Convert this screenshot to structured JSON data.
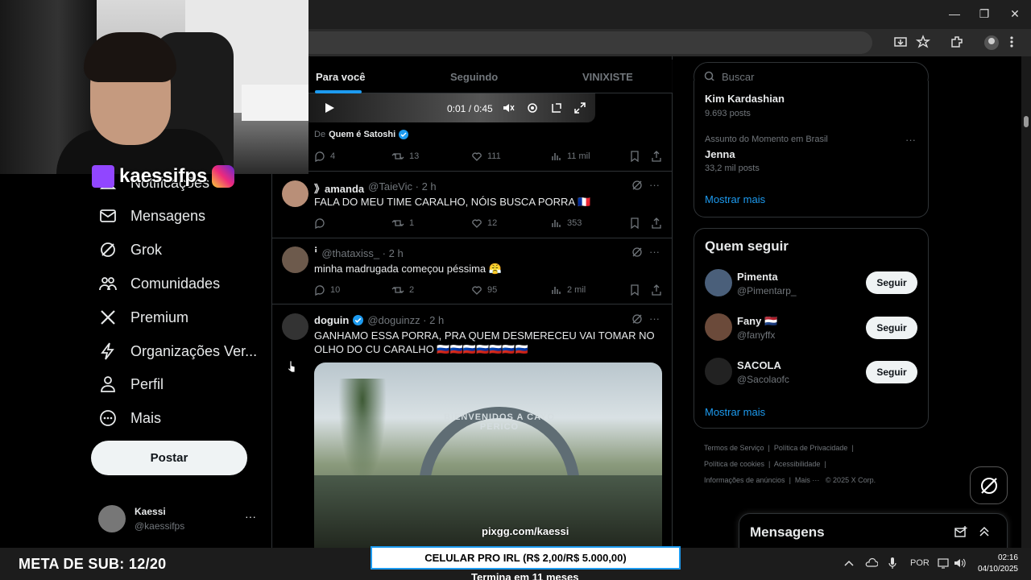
{
  "browser": {
    "window_controls": {
      "minimize": "—",
      "restore": "❐",
      "close": "✕"
    }
  },
  "stream": {
    "channel_name": "kaessifps",
    "meta_sub": "META DE SUB: 12/20",
    "goal_banner": "CELULAR PRO IRL (R$ 2,00/R$ 5.000,00)",
    "goal_sub": "Termina em 11 meses",
    "watermark": "pixgg.com/kaessi"
  },
  "sidebar": {
    "items": [
      {
        "label": "Notificações",
        "icon": "bell-icon"
      },
      {
        "label": "Mensagens",
        "icon": "mail-icon"
      },
      {
        "label": "Grok",
        "icon": "grok-icon"
      },
      {
        "label": "Comunidades",
        "icon": "communities-icon"
      },
      {
        "label": "Premium",
        "icon": "x-logo-icon"
      },
      {
        "label": "Organizações Ver...",
        "icon": "lightning-icon"
      },
      {
        "label": "Perfil",
        "icon": "person-icon"
      },
      {
        "label": "Mais",
        "icon": "more-circle-icon"
      }
    ],
    "post_button": "Postar",
    "account": {
      "name": "Kaessi",
      "handle": "@kaessifps",
      "more": "···"
    }
  },
  "feed": {
    "tabs": [
      "Para você",
      "Seguindo",
      "VINIXISTE"
    ],
    "video": {
      "time": "0:01 / 0:45"
    },
    "tweets": [
      {
        "from_prefix": "De",
        "from_name": "Quem é Satoshi",
        "replies": "4",
        "reposts": "13",
        "likes": "111",
        "views": "11 mil"
      },
      {
        "name": "》amanda",
        "handle": "@TaieVic · 2 h",
        "text": "FALA DO MEU TIME CARALHO, NÓIS BUSCA PORRA 🇫🇷",
        "replies": "",
        "reposts": "1",
        "likes": "12",
        "views": "353"
      },
      {
        "name": "ꜞ",
        "handle": "@thataxiss_ · 2 h",
        "text": "minha madrugada começou péssima 😤",
        "replies": "10",
        "reposts": "2",
        "likes": "95",
        "views": "2 mil"
      },
      {
        "name": "doguin",
        "handle": "@doguinzz · 2 h",
        "text": "GANHAMO ESSA PORRA, PRA QUEM DESMERECEU VAI TOMAR NO OLHO DO CU CARALHO 🇷🇺🇷🇺🇷🇺🇷🇺🇷🇺🇷🇺🇷🇺",
        "media_sign": "BIENVENIDOS A CAYO PERICO"
      }
    ]
  },
  "right": {
    "search_placeholder": "Buscar",
    "trends": [
      {
        "name": "Kim Kardashian",
        "posts": "9.693 posts"
      },
      {
        "context": "Assunto do Momento em Brasil",
        "name": "Jenna",
        "posts": "33,2 mil posts"
      }
    ],
    "show_more": "Mostrar mais",
    "who_to_follow": {
      "title": "Quem seguir",
      "users": [
        {
          "name": "Pimenta",
          "handle": "@Pimentarp_",
          "button": "Seguir"
        },
        {
          "name": "Fany 🇳🇱",
          "handle": "@fanyffx",
          "button": "Seguir"
        },
        {
          "name": "SACOLA",
          "handle": "@Sacolaofc",
          "button": "Seguir"
        }
      ],
      "show_more": "Mostrar mais"
    },
    "footer": {
      "links": [
        "Termos de Serviço",
        "Política de Privacidade",
        "Política de cookies",
        "Acessibilidade",
        "Informações de anúncios",
        "Mais ···"
      ],
      "copyright": "© 2025 X Corp."
    },
    "messages_drawer": "Mensagens"
  },
  "taskbar": {
    "lang": "POR",
    "time": "02:16",
    "date": "04/10/2025"
  },
  "colors": {
    "accent": "#1d9bf0",
    "verified": "#1d9bf0",
    "twitch": "#9146ff"
  }
}
